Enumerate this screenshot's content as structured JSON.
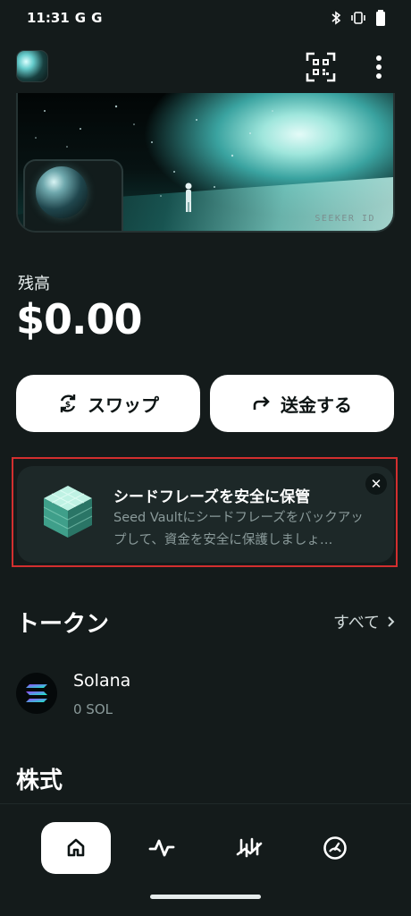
{
  "status_bar": {
    "time": "11:31",
    "notification_icons": [
      "G",
      "G"
    ],
    "right_icons": [
      "bluetooth-icon",
      "vibrate-icon",
      "battery-icon"
    ]
  },
  "top_bar": {
    "avatar": "profile-avatar",
    "qr_icon": "qr-scan-icon",
    "more_icon": "more-vertical-icon"
  },
  "hero": {
    "label": "SEEKER ID"
  },
  "balance": {
    "label": "残高",
    "value": "$0.00"
  },
  "actions": {
    "swap_label": "スワップ",
    "send_label": "送金する"
  },
  "promo": {
    "title": "シードフレーズを安全に保管",
    "body": "Seed Vaultにシードフレーズをバックアップして、資金を安全に保護しましょ…",
    "close_icon": "close-icon"
  },
  "tokens": {
    "title": "トークン",
    "see_all": "すべて",
    "items": [
      {
        "name": "Solana",
        "amount": "0 SOL",
        "icon": "solana-logo-icon"
      }
    ]
  },
  "stocks": {
    "title": "株式"
  },
  "bottom_nav": {
    "items": [
      {
        "icon": "home-icon",
        "selected": true
      },
      {
        "icon": "activity-icon",
        "selected": false
      },
      {
        "icon": "markets-chart-icon",
        "selected": false
      },
      {
        "icon": "dashboard-gauge-icon",
        "selected": false
      }
    ]
  },
  "colors": {
    "background": "#141b1b",
    "card": "#1d2828",
    "highlight_outline": "#d32f2f",
    "muted_text": "#8a9a9a"
  }
}
